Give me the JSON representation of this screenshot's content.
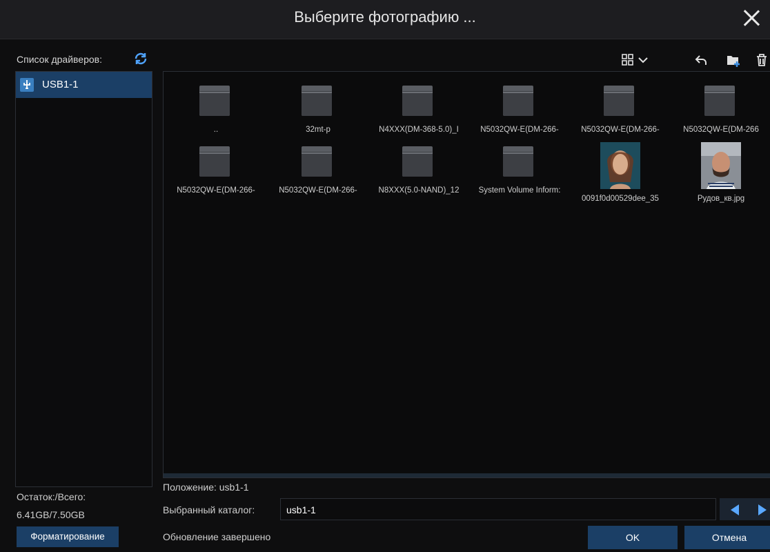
{
  "dialog": {
    "title": "Выберите фотографию ..."
  },
  "drivers": {
    "label": "Список драйверов:",
    "items": [
      {
        "name": "USB1-1"
      }
    ],
    "free_label": "Остаток:/Всего:",
    "free_value": "6.41GB/7.50GB",
    "format_button": "Форматирование"
  },
  "files": [
    {
      "name": "..",
      "type": "folder"
    },
    {
      "name": "32mt-p",
      "type": "folder"
    },
    {
      "name": "N4XXX(DM-368-5.0)_I",
      "type": "folder"
    },
    {
      "name": "N5032QW-E(DM-266-",
      "type": "folder"
    },
    {
      "name": "N5032QW-E(DM-266-",
      "type": "folder"
    },
    {
      "name": "N5032QW-E(DM-266",
      "type": "folder"
    },
    {
      "name": "N5032QW-E(DM-266-",
      "type": "folder"
    },
    {
      "name": "N5032QW-E(DM-266-",
      "type": "folder"
    },
    {
      "name": "N8XXX(5.0-NAND)_12",
      "type": "folder"
    },
    {
      "name": "System Volume Inform:",
      "type": "folder"
    },
    {
      "name": "0091f0d00529dee_35",
      "type": "image"
    },
    {
      "name": "Рудов_кв.jpg",
      "type": "image"
    }
  ],
  "location": "Положение: usb1-1",
  "selected_dir": {
    "label": "Выбранный каталог:",
    "value": "usb1-1"
  },
  "status": "Обновление завершено",
  "buttons": {
    "ok": "OK",
    "cancel": "Отмена"
  },
  "colors": {
    "accent": "#1b3f66",
    "background": "#0e0e0f",
    "arrow": "#5aa8ff"
  }
}
